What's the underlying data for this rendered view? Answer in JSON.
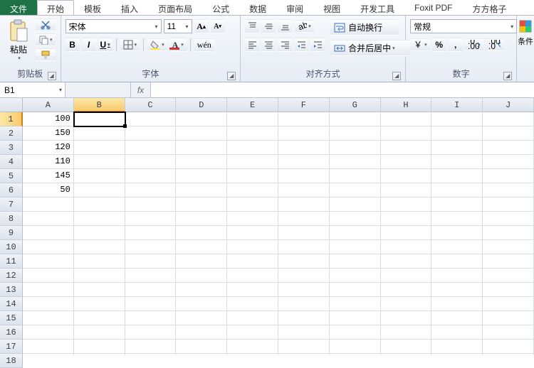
{
  "tabs": {
    "file": "文件",
    "start": "开始",
    "template": "模板",
    "insert": "插入",
    "layout": "页面布局",
    "formula": "公式",
    "data": "数据",
    "review": "审阅",
    "view": "视图",
    "dev": "开发工具",
    "foxit": "Foxit PDF",
    "fang": "方方格子"
  },
  "groups": {
    "clipboard": "剪贴板",
    "font": "字体",
    "align": "对齐方式",
    "number": "数字"
  },
  "clipboard": {
    "paste": "粘贴"
  },
  "font": {
    "name": "宋体",
    "size": "11",
    "B": "B",
    "I": "I",
    "U": "U"
  },
  "align": {
    "wrap": "自动换行",
    "merge": "合并后居中"
  },
  "number": {
    "format": "常规",
    "pct": "%",
    "comma": ","
  },
  "partial": {
    "label": "条件"
  },
  "namebox": "B1",
  "fx": "fx",
  "columns": [
    "A",
    "B",
    "C",
    "D",
    "E",
    "F",
    "G",
    "H",
    "I",
    "J"
  ],
  "rows": [
    1,
    2,
    3,
    4,
    5,
    6,
    7,
    8,
    9,
    10,
    11,
    12,
    13,
    14,
    15,
    16,
    17,
    18
  ],
  "cells": {
    "A1": "100",
    "A2": "150",
    "A3": "120",
    "A4": "110",
    "A5": "145",
    "A6": "50"
  },
  "activeCell": "B1"
}
